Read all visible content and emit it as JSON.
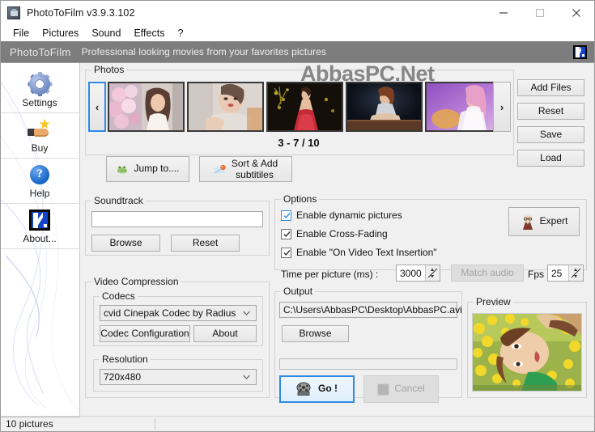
{
  "window": {
    "title": "PhotoToFilm v3.9.3.102",
    "icon": "app-icon",
    "controls": {
      "minimize": "minimize",
      "maximize": "maximize",
      "close": "close"
    }
  },
  "menu": {
    "items": [
      "File",
      "Pictures",
      "Sound",
      "Effects",
      "?"
    ]
  },
  "banner": {
    "brand": "PhotoToFilm",
    "tagline": "Professional looking movies from your favorites pictures",
    "logo": "k-logo-icon"
  },
  "sidebar": {
    "items": [
      {
        "label": "Settings",
        "icon": "gear-icon"
      },
      {
        "label": "Buy",
        "icon": "hand-star-icon"
      },
      {
        "label": "Help",
        "icon": "question-mark-icon"
      },
      {
        "label": "About...",
        "icon": "k-logo-icon"
      }
    ]
  },
  "watermark": {
    "text": "AbbasPC.Net"
  },
  "photos": {
    "title": "Photos",
    "prev_label": "‹",
    "next_label": "›",
    "counter": "3 - 7 / 10",
    "thumbnails": [
      {
        "alt": "bride with pink flower bouquet"
      },
      {
        "alt": "woman reclining with red lips"
      },
      {
        "alt": "woman in red dress dark background"
      },
      {
        "alt": "woman in silver dress at table"
      },
      {
        "alt": "woman with pink hair purple backdrop"
      }
    ],
    "jump_to_label": "Jump to....",
    "sort_add_label_line1": "Sort & Add",
    "sort_add_label_line2": "subtitiles",
    "jump_icon": "frog-icon",
    "sort_icon": "comet-icon"
  },
  "file_actions": {
    "add_files": "Add Files",
    "reset": "Reset",
    "save": "Save",
    "load": "Load"
  },
  "soundtrack": {
    "title": "Soundtrack",
    "value": "",
    "placeholder": "",
    "browse_label": "Browse",
    "reset_label": "Reset"
  },
  "options": {
    "title": "Options",
    "checkboxes": [
      {
        "label": "Enable dynamic pictures",
        "checked": true,
        "accent": true
      },
      {
        "label": "Enable Cross-Fading",
        "checked": true,
        "accent": false
      },
      {
        "label": "Enable \"On Video Text Insertion\"",
        "checked": true,
        "accent": false
      }
    ],
    "expert_label": "Expert",
    "expert_icon": "professor-icon",
    "time_per_picture_label": "Time per picture (ms) :",
    "time_per_picture_value": "3000",
    "match_audio_label": "Match audio",
    "match_audio_enabled": false,
    "fps_label": "Fps :",
    "fps_value": "25"
  },
  "video_compression": {
    "title": "Video Compression",
    "codecs_title": "Codecs",
    "codec_selected": "cvid Cinepak Codec by Radius",
    "codec_config_label": "Codec Configuration",
    "about_label": "About",
    "resolution_title": "Resolution",
    "resolution_selected": "720x480"
  },
  "output": {
    "title": "Output",
    "path": "C:\\Users\\AbbasPC\\Desktop\\AbbasPC.avi",
    "browse_label": "Browse",
    "progress_percent": 0,
    "go_label": "Go !",
    "go_icon": "film-reel-icon",
    "cancel_label": "Cancel",
    "cancel_enabled": false,
    "cancel_icon": "stop-icon"
  },
  "preview": {
    "title": "Preview",
    "alt": "woman lying in yellow flowers wearing green top"
  },
  "statusbar": {
    "text": "10 pictures"
  },
  "colors": {
    "accent": "#2e8ae6",
    "banner_bg": "#7d7d7d",
    "dialog_bg": "#f0f0f0",
    "brand_blue": "#1544c8"
  }
}
